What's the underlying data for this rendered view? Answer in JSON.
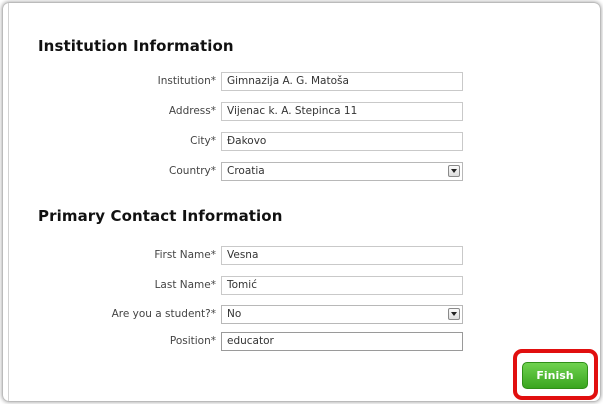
{
  "institution_section": {
    "title": "Institution Information",
    "fields": {
      "institution": {
        "label": "Institution*",
        "value": "Gimnazija A. G. Matoša"
      },
      "address": {
        "label": "Address*",
        "value": "Vijenac k. A. Stepinca 11"
      },
      "city": {
        "label": "City*",
        "value": "Đakovo"
      },
      "country": {
        "label": "Country*",
        "value": "Croatia"
      }
    }
  },
  "contact_section": {
    "title": "Primary Contact Information",
    "fields": {
      "first_name": {
        "label": "First Name*",
        "value": "Vesna"
      },
      "last_name": {
        "label": "Last Name*",
        "value": "Tomić"
      },
      "student": {
        "label": "Are you a student?*",
        "value": "No"
      },
      "position": {
        "label": "Position*",
        "value": "educator"
      }
    }
  },
  "actions": {
    "finish_label": "Finish"
  },
  "colors": {
    "finish_button": "#4cb52f",
    "highlight_border": "#e10f0f"
  }
}
